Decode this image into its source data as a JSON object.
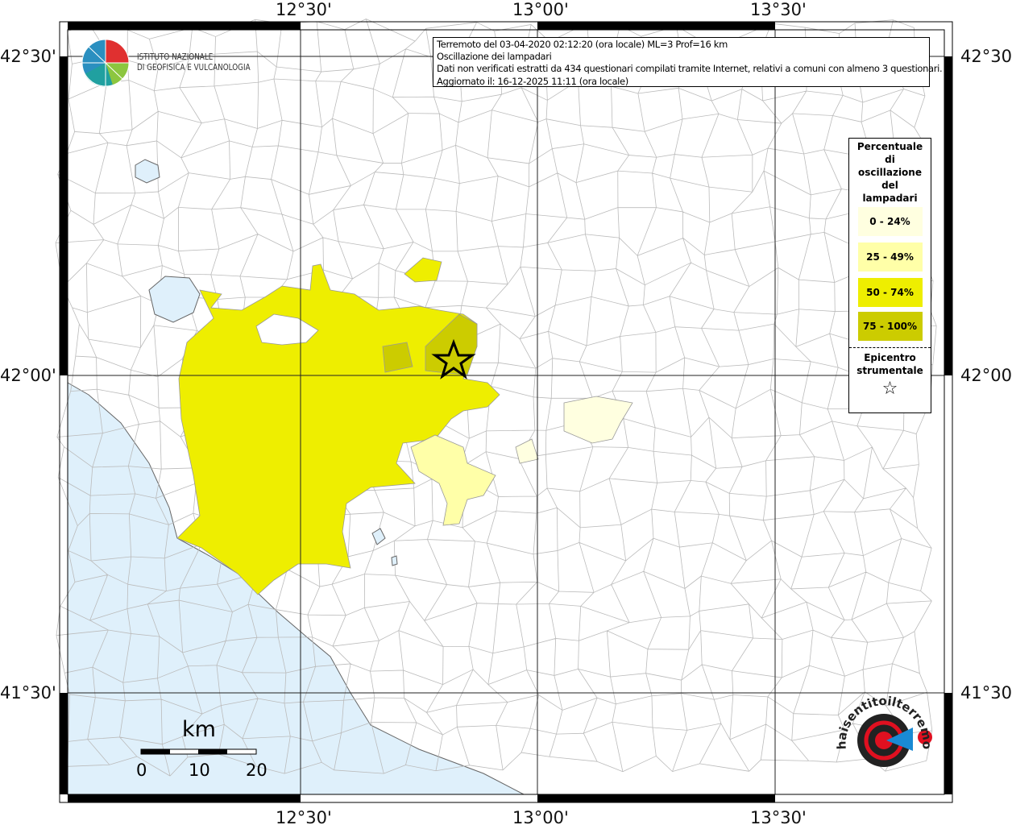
{
  "map": {
    "lon_labels": [
      "12°30'",
      "13°00'",
      "13°30'"
    ],
    "lat_labels": [
      "42°30'",
      "42°00'",
      "41°30'"
    ],
    "colors": {
      "sea": "#dff0fb",
      "land": "#ffffff",
      "borders": "#b0b0b0",
      "class_0_24": "#ffffe0",
      "class_25_49": "#ffffa8",
      "class_50_74": "#eeee00",
      "class_75_100": "#cccc00"
    }
  },
  "info": {
    "line1": "Terremoto del 03-04-2020 02:12:20 (ora locale) ML=3 Prof=16 km",
    "line2": "Oscillazione dei lampadari",
    "line3": "Dati non verificati estratti da 434 questionari compilati tramite Internet, relativi a comuni con almeno 3 questionari.",
    "line4": "Aggiornato il: 16-12-2025 11:11 (ora locale)"
  },
  "legend": {
    "title_lines": [
      "Percentuale",
      "di",
      "oscillazione",
      "del",
      "lampadari"
    ],
    "classes": [
      {
        "label": "0 - 24%",
        "color": "#ffffe0"
      },
      {
        "label": "25 - 49%",
        "color": "#ffffa8"
      },
      {
        "label": "50 - 74%",
        "color": "#eeee00"
      },
      {
        "label": "75 - 100%",
        "color": "#cccc00"
      }
    ],
    "epicenter_lines": [
      "Epicentro",
      "strumentale"
    ],
    "epicenter_icon": "star-outline-icon",
    "star": "☆"
  },
  "logo_ingv": {
    "line1": "ISTITUTO NAZIONALE",
    "line2": "DI GEOFISICA E VULCANOLOGIA"
  },
  "logo_hsit": {
    "text": "www.haisentitoilterremoto.it"
  },
  "scale": {
    "unit": "km",
    "ticks": [
      "0",
      "10",
      "20"
    ]
  }
}
